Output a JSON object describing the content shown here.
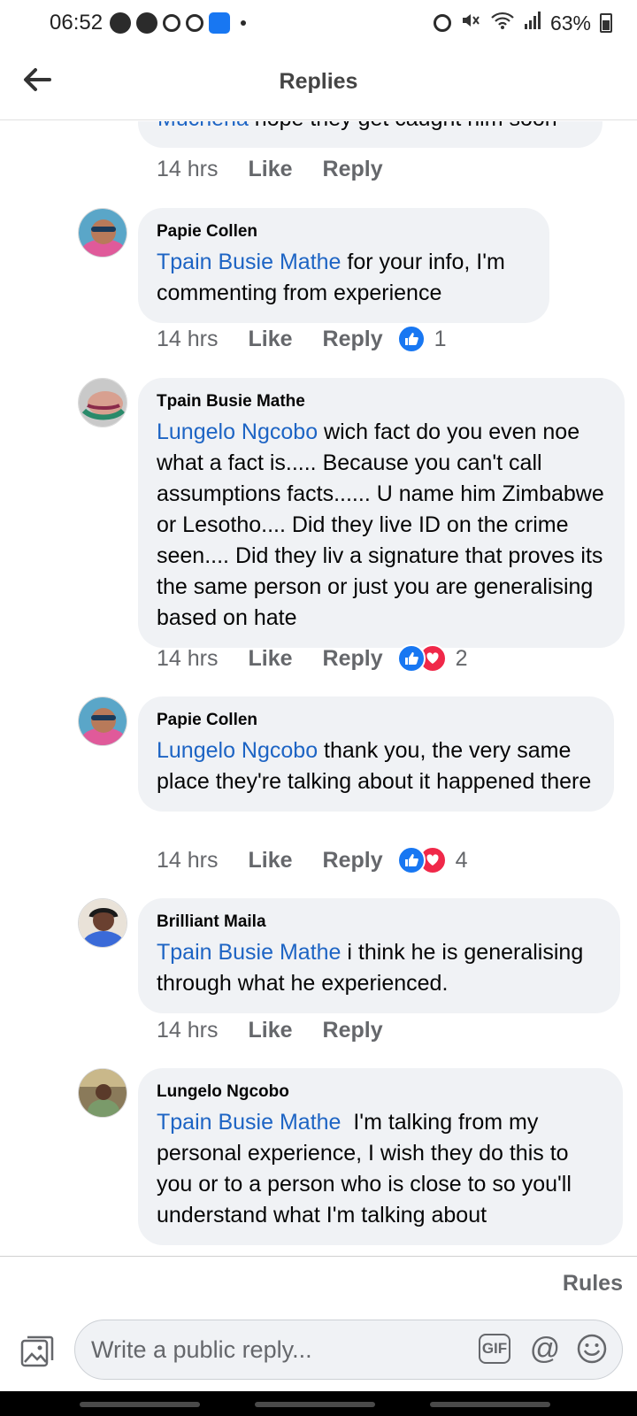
{
  "status_bar": {
    "time": "06:52",
    "battery": "63%"
  },
  "header": {
    "title": "Replies",
    "back_icon": "arrow-left-icon"
  },
  "partial_comment": {
    "mention": "Muchena",
    "text": " hope they get caught him soon",
    "time": "14 hrs",
    "like_label": "Like",
    "reply_label": "Reply"
  },
  "comments": [
    {
      "author": "Papie Collen",
      "mention": "Tpain Busie Mathe",
      "text": " for your info, I'm commenting from experience",
      "time": "14 hrs",
      "like_label": "Like",
      "reply_label": "Reply",
      "reaction_count": "1"
    },
    {
      "author": "Tpain Busie Mathe",
      "mention": "Lungelo Ngcobo",
      "text": " wich fact do you even noe what a fact is..... Because you can't call assumptions facts...... U name him Zimbabwe or Lesotho.... Did they live ID on the crime seen.... Did they liv a signature that proves its the same person or just you are generalising based on hate",
      "time": "14 hrs",
      "like_label": "Like",
      "reply_label": "Reply",
      "reaction_count": "2"
    },
    {
      "author": "Papie Collen",
      "mention": "Lungelo Ngcobo",
      "text": " thank you, the very same place they're talking about it happened there",
      "time": "14 hrs",
      "like_label": "Like",
      "reply_label": "Reply",
      "reaction_count": "4"
    },
    {
      "author": "Brilliant Maila",
      "mention": "Tpain Busie Mathe",
      "text": " i think he is generalising through what he experienced.",
      "time": "14 hrs",
      "like_label": "Like",
      "reply_label": "Reply"
    },
    {
      "author": "Lungelo Ngcobo",
      "mention": "Tpain Busie Mathe",
      "text": "  I'm talking from my personal experience, I wish they do this to you or to a person who is close to so you'll understand what I'm talking about"
    }
  ],
  "footer": {
    "rules_label": "Rules",
    "reply_placeholder": "Write a public reply...",
    "gif_label": "GIF",
    "at_label": "@"
  },
  "colors": {
    "mention": "#1d64c4",
    "bubble": "#f0f2f5",
    "like": "#1877f2",
    "love": "#f02849",
    "meta_text": "#65676b"
  }
}
